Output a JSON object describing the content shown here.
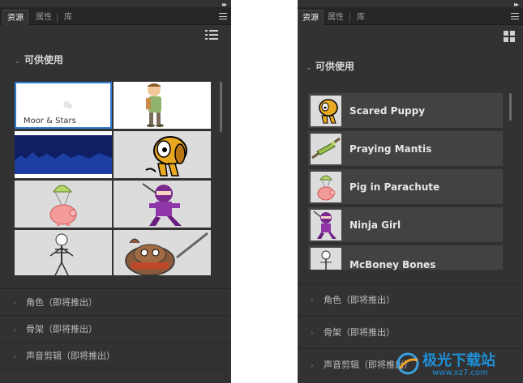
{
  "left_panel": {
    "tabs": [
      "资源",
      "属性",
      "库"
    ],
    "available_section": "可供使用",
    "tiles": [
      {
        "name": "moor-stars",
        "caption": "Moor & Stars"
      },
      {
        "name": "character-boy",
        "caption": ""
      },
      {
        "name": "mountain-night",
        "caption": ""
      },
      {
        "name": "scared-puppy",
        "caption": ""
      },
      {
        "name": "pig-parachute",
        "caption": ""
      },
      {
        "name": "ninja-girl",
        "caption": ""
      },
      {
        "name": "mcboney-bones",
        "caption": ""
      },
      {
        "name": "warrior-pig",
        "caption": ""
      }
    ],
    "collapsed_sections": [
      "角色（即将推出）",
      "骨架（即将推出）",
      "声音剪辑（即将推出）"
    ],
    "view_icon": "list-view-icon"
  },
  "right_panel": {
    "tabs": [
      "资源",
      "属性",
      "库"
    ],
    "available_section": "可供使用",
    "items": [
      "Scared Puppy",
      "Praying Mantis",
      "Pig in Parachute",
      "Ninja Girl",
      "McBoney Bones"
    ],
    "collapsed_sections": [
      "角色（即将推出）",
      "骨架（即将推出）",
      "声音剪辑（即将推出）"
    ],
    "view_icon": "grid-view-icon"
  },
  "watermark": {
    "brand": "极光下载站",
    "url": "www.xz7.com"
  },
  "colors": {
    "panel": "#323232",
    "tabbar": "#262626",
    "selected_border": "#2e7ad1",
    "list_row": "#424242"
  }
}
